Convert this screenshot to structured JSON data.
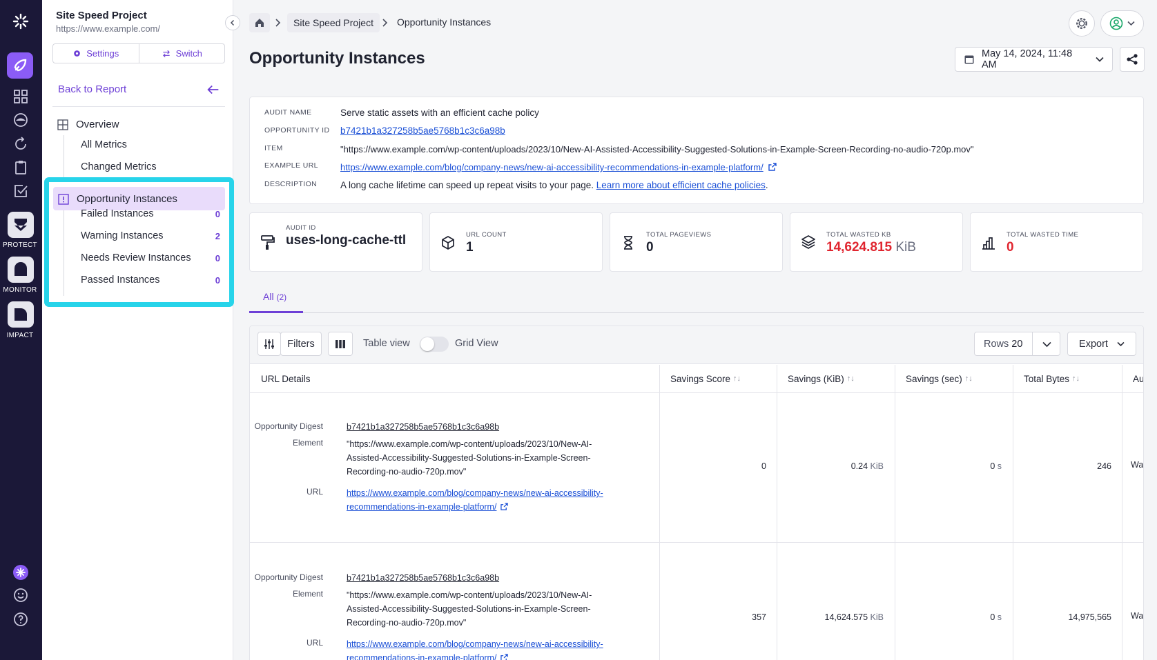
{
  "rail": {
    "protect": "PROTECT",
    "monitor": "MONITOR",
    "impact": "IMPACT"
  },
  "sidebar": {
    "project_name": "Site Speed Project",
    "project_url": "https://www.example.com/",
    "settings_label": "Settings",
    "switch_label": "Switch",
    "back_label": "Back to Report",
    "overview_label": "Overview",
    "items": [
      {
        "label": "All Metrics"
      },
      {
        "label": "Changed Metrics"
      }
    ],
    "opportunity_label": "Opportunity Instances",
    "instances": [
      {
        "label": "Failed Instances",
        "count": "0"
      },
      {
        "label": "Warning Instances",
        "count": "2"
      },
      {
        "label": "Needs Review Instances",
        "count": "0"
      },
      {
        "label": "Passed Instances",
        "count": "0"
      }
    ]
  },
  "breadcrumb": {
    "project": "Site Speed Project",
    "current": "Opportunity Instances"
  },
  "page_title": "Opportunity Instances",
  "date_selector": "May 14, 2024, 11:48 AM",
  "audit": {
    "name_label": "AUDIT NAME",
    "name": "Serve static assets with an efficient cache policy",
    "opp_id_label": "OPPORTUNITY ID",
    "opp_id": "b7421b1a327258b5ae5768b1c3c6a98b",
    "item_label": "ITEM",
    "item": "\"https://www.example.com/wp-content/uploads/2023/10/New-AI-Assisted-Accessibility-Suggested-Solutions-in-Example-Screen-Recording-no-audio-720p.mov\"",
    "example_url_label": "EXAMPLE URL",
    "example_url": "https://www.example.com/blog/company-news/new-ai-accessibility-recommendations-in-example-platform/",
    "description_label": "DESCRIPTION",
    "description": "A long cache lifetime can speed up repeat visits to your page.",
    "description_link": "Learn more about efficient cache policies",
    "description_end": "."
  },
  "stats": [
    {
      "label": "AUDIT ID",
      "value": "uses-long-cache-ttl",
      "icon": "paint-roller-icon"
    },
    {
      "label": "URL COUNT",
      "value": "1",
      "icon": "cube-icon"
    },
    {
      "label": "TOTAL PAGEVIEWS",
      "value": "0",
      "icon": "hourglass-icon"
    },
    {
      "label": "TOTAL WASTED KB",
      "value": "14,624.815",
      "unit": "KiB",
      "icon": "layers-icon"
    },
    {
      "label": "TOTAL WASTED TIME",
      "value": "0",
      "icon": "bar-chart-icon"
    }
  ],
  "tabs": {
    "all_label": "All",
    "all_count": "(2)"
  },
  "toolbar": {
    "filters_label": "Filters",
    "table_view_label": "Table view",
    "grid_view_label": "Grid View",
    "rows_label": "Rows",
    "rows_value": "20",
    "export_label": "Export"
  },
  "table": {
    "columns": [
      "URL Details",
      "Savings Score",
      "Savings (KiB)",
      "Savings (sec)",
      "Total Bytes",
      "Au"
    ],
    "detail_labels": {
      "digest": "Opportunity Digest",
      "element": "Element",
      "url": "URL"
    },
    "rows": [
      {
        "digest": "b7421b1a327258b5ae5768b1c3c6a98b",
        "element": "\"https://www.example.com/wp-content/uploads/2023/10/New-AI-Assisted-Accessibility-Suggested-Solutions-in-Example-Screen-Recording-no-audio-720p.mov\"",
        "url": "https://www.example.com/blog/company-news/new-ai-accessibility-recommendations-in-example-platform/",
        "score": "0",
        "savings_kib": "0.24",
        "savings_sec": "0",
        "total_bytes": "246",
        "au": "Wa"
      },
      {
        "digest": "b7421b1a327258b5ae5768b1c3c6a98b",
        "element": "\"https://www.example.com/wp-content/uploads/2023/10/New-AI-Assisted-Accessibility-Suggested-Solutions-in-Example-Screen-Recording-no-audio-720p.mov\"",
        "url": "https://www.example.com/blog/company-news/new-ai-accessibility-recommendations-in-example-platform/",
        "score": "357",
        "savings_kib": "14,624.575",
        "savings_sec": "0",
        "total_bytes": "14,975,565",
        "au": "Wa"
      }
    ],
    "kib_unit": "KiB",
    "sec_unit": "s"
  },
  "colors": {
    "accent": "#6d3fd6",
    "highlight": "#27d4ea",
    "rail": "#1b1838",
    "danger": "#e0252f"
  }
}
